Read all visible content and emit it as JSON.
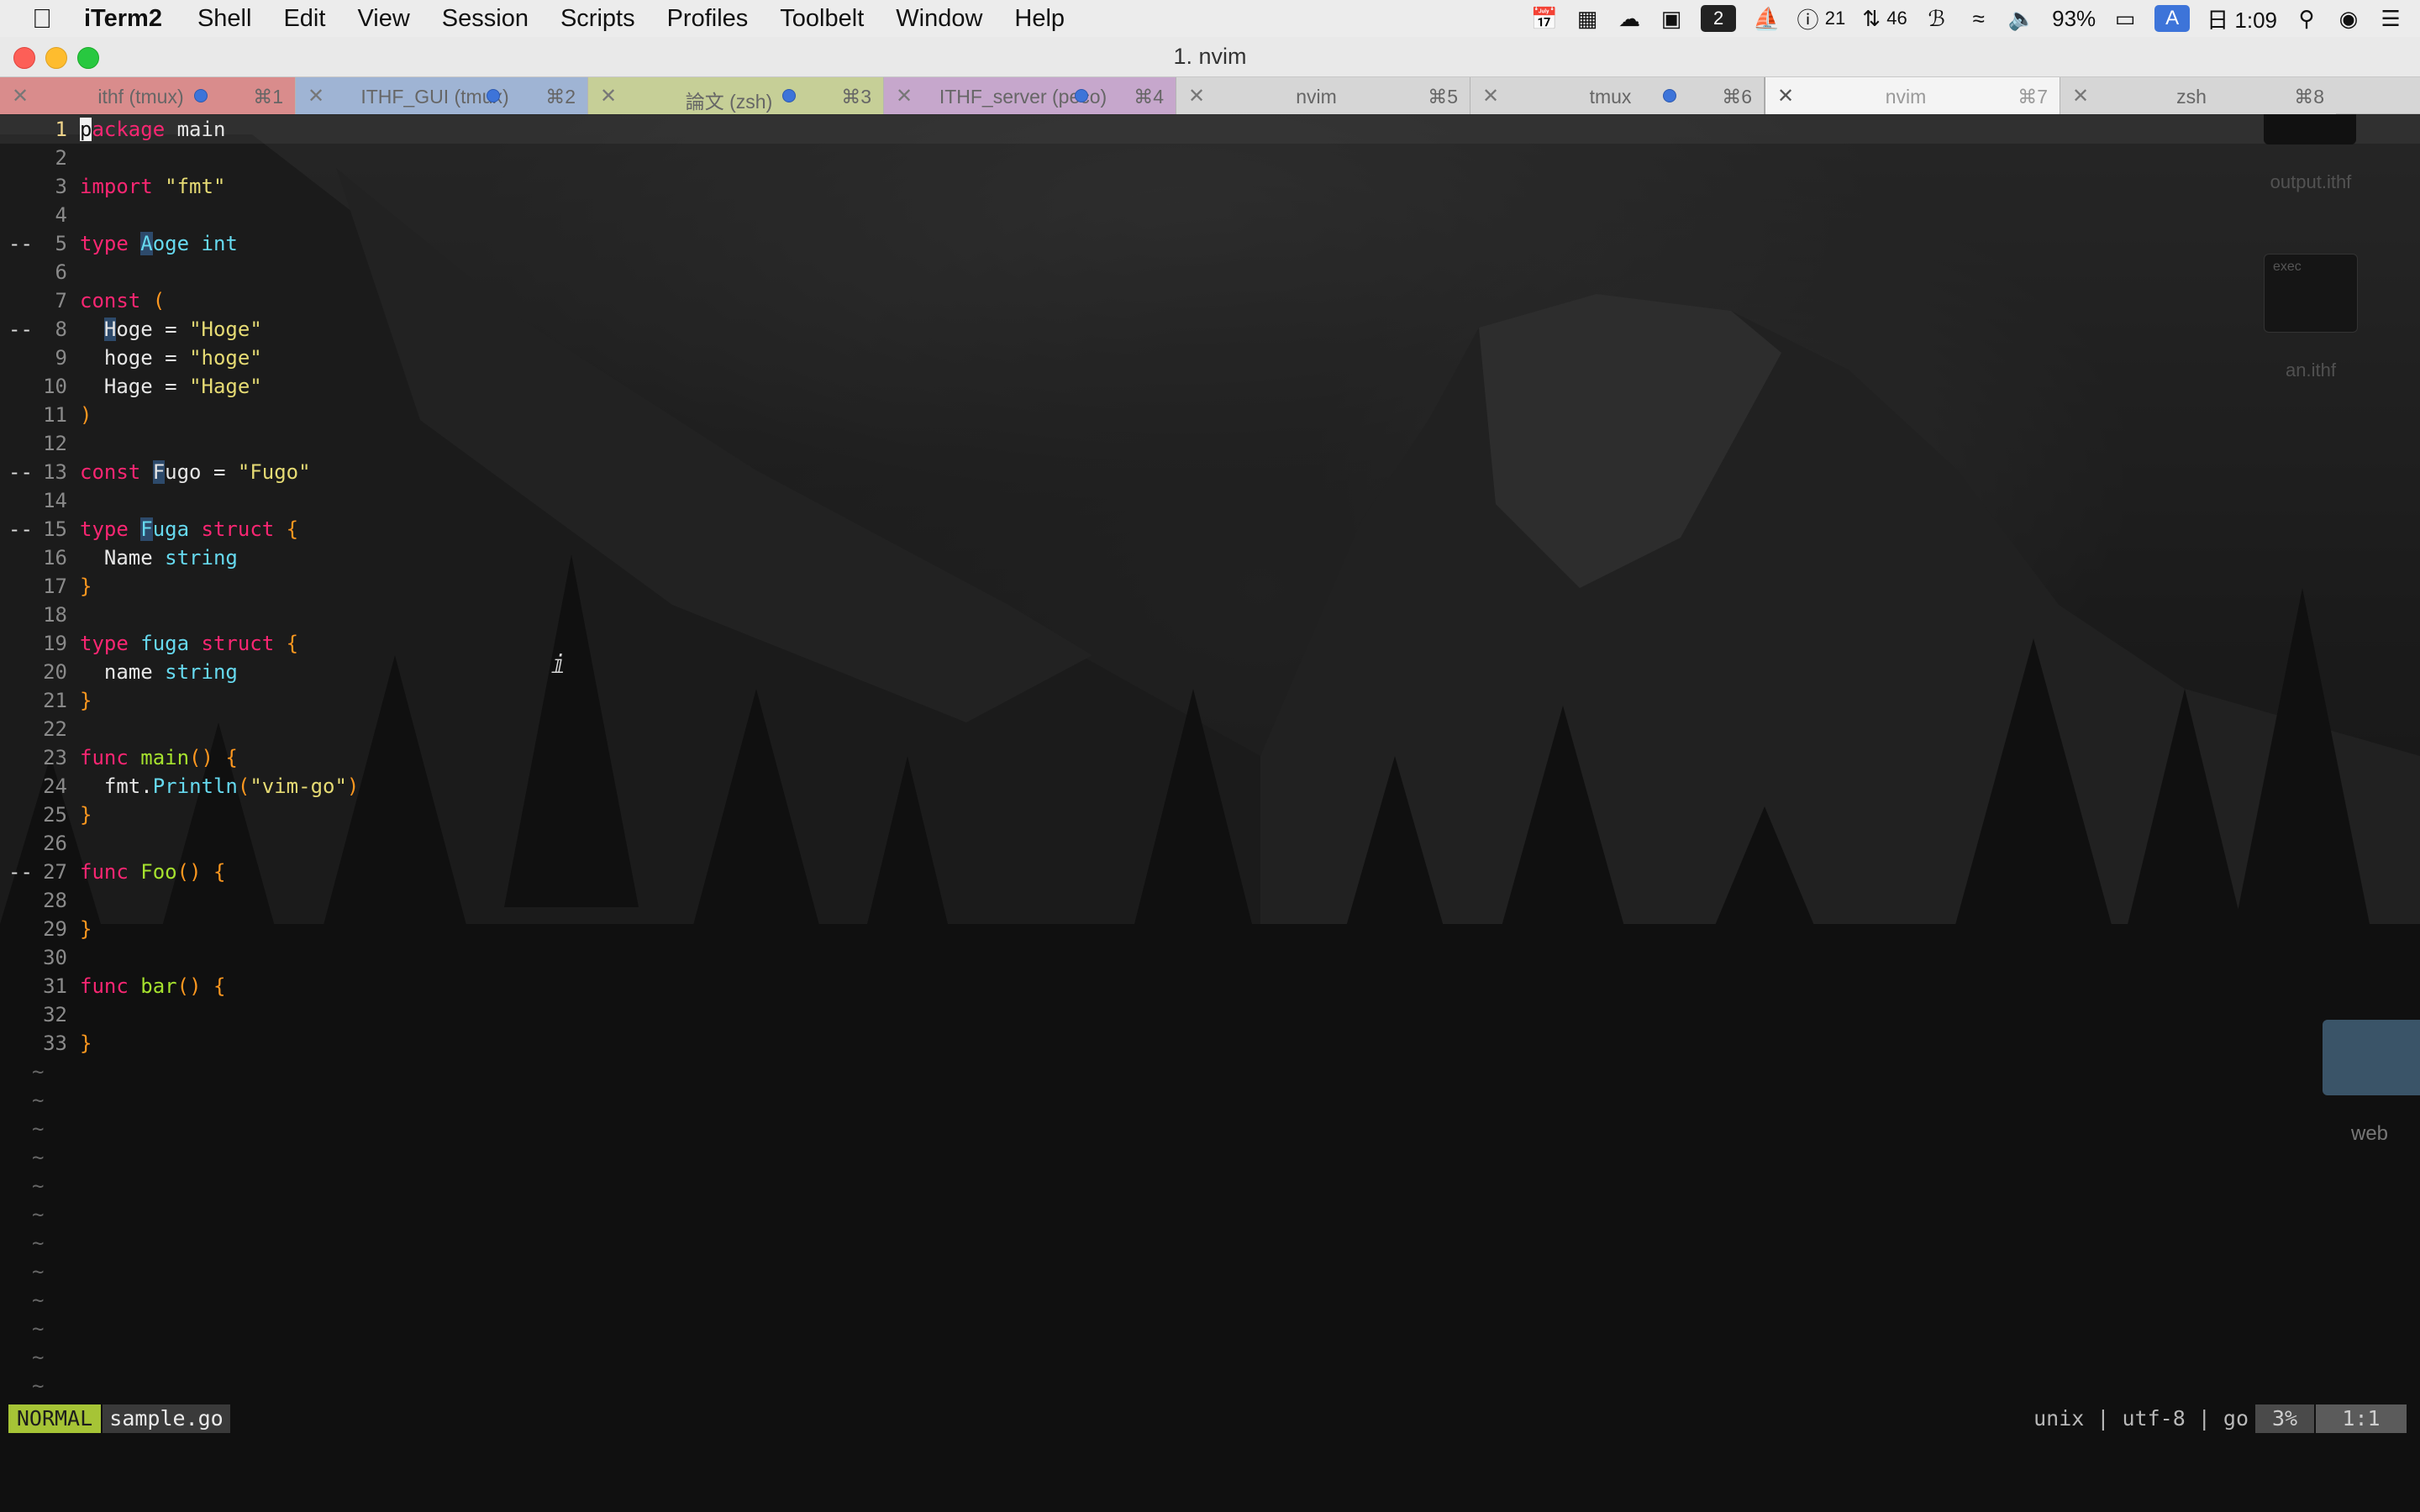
{
  "menubar": {
    "app_name": "iTerm2",
    "items": [
      "Shell",
      "Edit",
      "View",
      "Session",
      "Scripts",
      "Profiles",
      "Toolbelt",
      "Window",
      "Help"
    ],
    "status": {
      "num2": "2",
      "issues": "21",
      "prs": "46",
      "battery": "93%",
      "input_source": "A",
      "clock": "日 1:09"
    }
  },
  "window": {
    "title": "1. nvim"
  },
  "tabs": [
    {
      "label": "ithf (tmux)",
      "shortcut": "⌘1",
      "color": "#d98c8c",
      "dot": true
    },
    {
      "label": "ITHF_GUI (tmux)",
      "shortcut": "⌘2",
      "color": "#9fb4d4",
      "dot": true
    },
    {
      "label": "論文 (zsh)",
      "shortcut": "⌘3",
      "color": "#c6cf97",
      "dot": true
    },
    {
      "label": "ITHF_server (peco)",
      "shortcut": "⌘4",
      "color": "#c6a7cc",
      "dot": true
    },
    {
      "label": "nvim",
      "shortcut": "⌘5",
      "color": "#d6d6d6",
      "dot": false
    },
    {
      "label": "tmux",
      "shortcut": "⌘6",
      "color": "#d6d6d6",
      "dot": true
    },
    {
      "label": "nvim",
      "shortcut": "⌘7",
      "color": "#f4f4f4",
      "dot": false,
      "active": true
    },
    {
      "label": "zsh",
      "shortcut": "⌘8",
      "color": "#d6d6d6",
      "dot": false
    }
  ],
  "editor": {
    "lines": [
      {
        "n": "1",
        "mark": "",
        "t": "package main"
      },
      {
        "n": "2",
        "mark": "",
        "t": ""
      },
      {
        "n": "3",
        "mark": "",
        "t": "import \"fmt\""
      },
      {
        "n": "4",
        "mark": "",
        "t": ""
      },
      {
        "n": "5",
        "mark": "--",
        "t": "type Aoge int"
      },
      {
        "n": "6",
        "mark": "",
        "t": ""
      },
      {
        "n": "7",
        "mark": "",
        "t": "const ("
      },
      {
        "n": "8",
        "mark": "--",
        "t": "  Hoge = \"Hoge\""
      },
      {
        "n": "9",
        "mark": "",
        "t": "  hoge = \"hoge\""
      },
      {
        "n": "10",
        "mark": "",
        "t": "  Hage = \"Hage\""
      },
      {
        "n": "11",
        "mark": "",
        "t": ")"
      },
      {
        "n": "12",
        "mark": "",
        "t": ""
      },
      {
        "n": "13",
        "mark": "--",
        "t": "const Fugo = \"Fugo\""
      },
      {
        "n": "14",
        "mark": "",
        "t": ""
      },
      {
        "n": "15",
        "mark": "--",
        "t": "type Fuga struct {"
      },
      {
        "n": "16",
        "mark": "",
        "t": "  Name string"
      },
      {
        "n": "17",
        "mark": "",
        "t": "}"
      },
      {
        "n": "18",
        "mark": "",
        "t": ""
      },
      {
        "n": "19",
        "mark": "",
        "t": "type fuga struct {"
      },
      {
        "n": "20",
        "mark": "",
        "t": "  name string"
      },
      {
        "n": "21",
        "mark": "",
        "t": "}"
      },
      {
        "n": "22",
        "mark": "",
        "t": ""
      },
      {
        "n": "23",
        "mark": "",
        "t": "func main() {"
      },
      {
        "n": "24",
        "mark": "",
        "t": "  fmt.Println(\"vim-go\")"
      },
      {
        "n": "25",
        "mark": "",
        "t": "}"
      },
      {
        "n": "26",
        "mark": "",
        "t": ""
      },
      {
        "n": "27",
        "mark": "--",
        "t": "func Foo() {"
      },
      {
        "n": "28",
        "mark": "",
        "t": ""
      },
      {
        "n": "29",
        "mark": "",
        "t": "}"
      },
      {
        "n": "30",
        "mark": "",
        "t": ""
      },
      {
        "n": "31",
        "mark": "",
        "t": "func bar() {"
      },
      {
        "n": "32",
        "mark": "",
        "t": ""
      },
      {
        "n": "33",
        "mark": "",
        "t": "}"
      }
    ],
    "tilde": "~",
    "tilde_count": 12
  },
  "statusline": {
    "mode": "NORMAL",
    "filename": "sample.go",
    "fileinfo": "unix | utf-8 | go",
    "percent": "3%",
    "position": "1:1"
  },
  "desktop": {
    "icons": [
      {
        "label": "output.ithf"
      },
      {
        "label": "exec",
        "sublabel": "an.ithf"
      },
      {
        "label": "web"
      }
    ]
  }
}
